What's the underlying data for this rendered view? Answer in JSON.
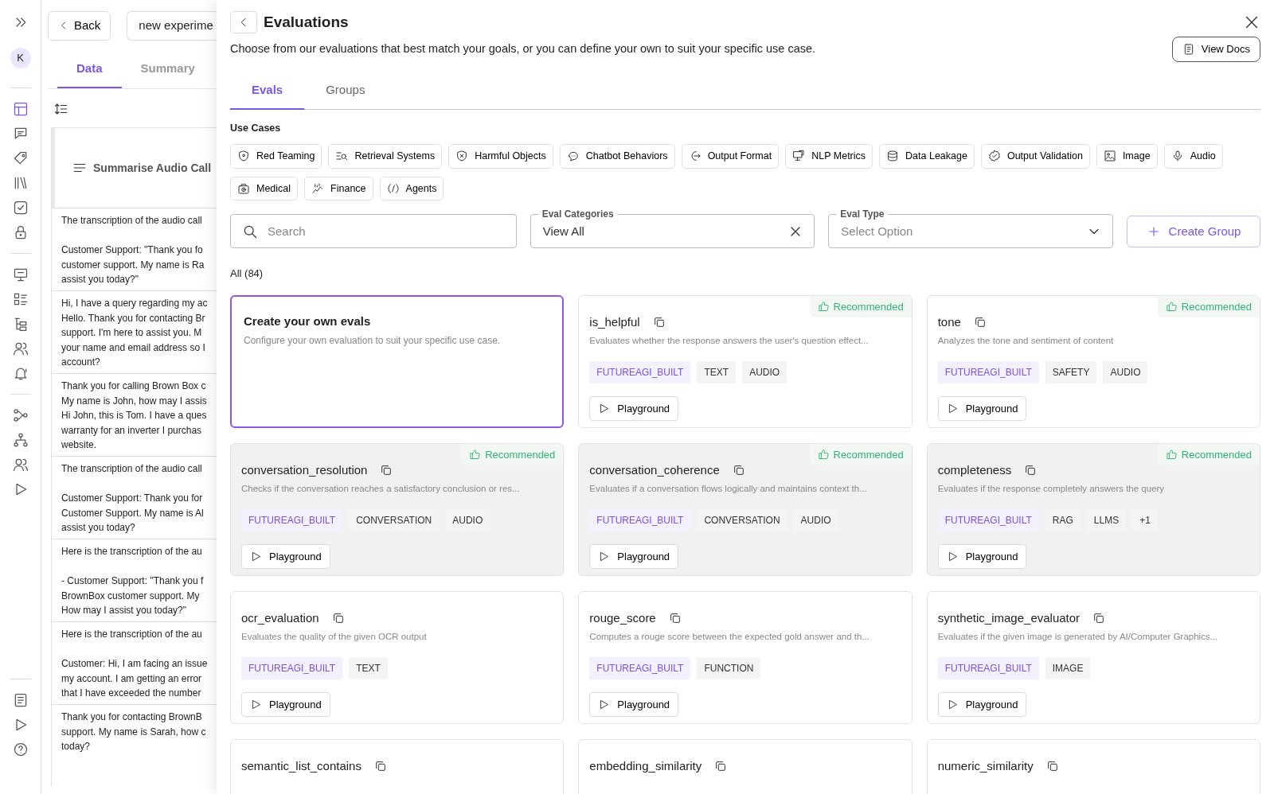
{
  "rail": {
    "avatar": "K",
    "sections": [
      [
        {
          "selected": true
        },
        {
          "selected": false
        },
        {
          "selected": false
        },
        {
          "selected": false
        },
        {
          "selected": false
        },
        {
          "selected": false
        }
      ],
      [
        {
          "selected": false
        },
        {
          "selected": false
        },
        {
          "selected": false
        },
        {
          "selected": false
        },
        {
          "selected": false
        }
      ],
      [
        {
          "selected": false
        },
        {
          "selected": false
        },
        {
          "selected": false
        },
        {
          "selected": false
        }
      ],
      [
        {
          "selected": false
        },
        {
          "selected": false
        },
        {
          "selected": false
        }
      ]
    ]
  },
  "background_page": {
    "back_button": "Back",
    "experiment_name": "new experime",
    "tabs": [
      {
        "label": "Data",
        "selected": true
      },
      {
        "label": "Summary",
        "selected": false
      }
    ],
    "column_header": "Summarise Audio Call",
    "rows": [
      "The transcription of the audio call\n\nCustomer Support: \"Thank you fo\ncustomer support. My name is Ra\nassist you today?\"",
      "Hi, I have a query regarding my ac\nHello. Thank you for contacting Br\nsupport. I'm here to assist you. M\nyour name and email address so I\naccount?",
      "Thank you for calling Brown Box c\nMy name is John, how may I assis\nHi John, this is Tom. I have a ques\nwarranty for an inverter I purchas\nwebsite.",
      "The transcription of the audio call\n\nCustomer Support: Thank you for\nCustomer Support. My name is Al\nassist you today?",
      "Here is the transcription of the au\n\n- Customer Support: \"Thank you f\nBrownBox customer support. My\nHow may I assist you today?\"",
      "Here is the transcription of the au\n\nCustomer: Hi, I am facing an issue\nmy account. I am getting an error\nthat I have exceeded the number",
      "Thank you for contacting BrownB\nsupport. My name is Sarah, how c\ntoday?"
    ]
  },
  "drawer": {
    "title": "Evaluations",
    "subtitle": "Choose from our evaluations that best match your goals, or you can define your own to suit your specific use case.",
    "view_docs_button": "View Docs",
    "tabs": [
      {
        "label": "Evals",
        "selected": true
      },
      {
        "label": "Groups",
        "selected": false
      }
    ],
    "use_cases_label": "Use Cases",
    "use_cases": [
      "Red Teaming",
      "Retrieval Systems",
      "Harmful Objects",
      "Chatbot Behaviors",
      "Output Format",
      "NLP Metrics",
      "Data Leakage",
      "Output Validation",
      "Image",
      "Audio",
      "Medical",
      "Finance",
      "Agents"
    ],
    "search": {
      "placeholder": "Search"
    },
    "eval_categories": {
      "label": "Eval Categories",
      "value": "View All"
    },
    "eval_type": {
      "label": "Eval Type",
      "placeholder": "Select Option"
    },
    "create_group_button": "Create Group",
    "count_label": "All (84)",
    "create_card": {
      "selected": true,
      "title": "Create your own evals",
      "description": "Configure your own evaluation to suit your specific use case."
    },
    "cards": [
      {
        "kind": "eval",
        "name": "is_helpful",
        "description": "Evaluates whether the response answers the user's question effect...",
        "recommended": true,
        "badge": "Recommended",
        "shaded": false,
        "tags": [
          {
            "text": "FUTUREAGI_BUILT",
            "kind": "source"
          },
          {
            "text": "TEXT",
            "kind": "type"
          },
          {
            "text": "AUDIO",
            "kind": "type"
          }
        ],
        "button": "Playground"
      },
      {
        "kind": "eval",
        "name": "tone",
        "description": "Analyzes the tone and sentiment of content",
        "recommended": true,
        "badge": "Recommended",
        "shaded": false,
        "tags": [
          {
            "text": "FUTUREAGI_BUILT",
            "kind": "source"
          },
          {
            "text": "SAFETY",
            "kind": "type"
          },
          {
            "text": "AUDIO",
            "kind": "type"
          }
        ],
        "button": "Playground"
      },
      {
        "kind": "eval",
        "name": "conversation_resolution",
        "description": "Checks if the conversation reaches a satisfactory conclusion or res...",
        "recommended": true,
        "badge": "Recommended",
        "shaded": true,
        "tags": [
          {
            "text": "FUTUREAGI_BUILT",
            "kind": "source"
          },
          {
            "text": "CONVERSATION",
            "kind": "type"
          },
          {
            "text": "AUDIO",
            "kind": "type"
          }
        ],
        "button": "Playground"
      },
      {
        "kind": "eval",
        "name": "conversation_coherence",
        "description": "Evaluates if a conversation flows logically and maintains context th...",
        "recommended": true,
        "badge": "Recommended",
        "shaded": true,
        "tags": [
          {
            "text": "FUTUREAGI_BUILT",
            "kind": "source"
          },
          {
            "text": "CONVERSATION",
            "kind": "type"
          },
          {
            "text": "AUDIO",
            "kind": "type"
          }
        ],
        "button": "Playground"
      },
      {
        "kind": "eval",
        "name": "completeness",
        "description": "Evaluates if the response completely answers the query",
        "recommended": true,
        "badge": "Recommended",
        "shaded": true,
        "tags": [
          {
            "text": "FUTUREAGI_BUILT",
            "kind": "source"
          },
          {
            "text": "RAG",
            "kind": "type"
          },
          {
            "text": "LLMS",
            "kind": "type"
          },
          {
            "text": "+1",
            "kind": "type"
          }
        ],
        "button": "Playground"
      },
      {
        "kind": "eval",
        "name": "ocr_evaluation",
        "description": "Evaluates the quality of the given OCR output",
        "recommended": false,
        "shaded": false,
        "tags": [
          {
            "text": "FUTUREAGI_BUILT",
            "kind": "source"
          },
          {
            "text": "TEXT",
            "kind": "type"
          }
        ],
        "button": "Playground"
      },
      {
        "kind": "eval",
        "name": "rouge_score",
        "description": "Computes a rouge score between the expected gold answer and th...",
        "recommended": false,
        "shaded": false,
        "tags": [
          {
            "text": "FUTUREAGI_BUILT",
            "kind": "source"
          },
          {
            "text": "FUNCTION",
            "kind": "type"
          }
        ],
        "button": "Playground"
      },
      {
        "kind": "eval",
        "name": "synthetic_image_evaluator",
        "description": "Evaluates if the given image is generated by AI/Computer Graphics...",
        "recommended": false,
        "shaded": false,
        "tags": [
          {
            "text": "FUTUREAGI_BUILT",
            "kind": "source"
          },
          {
            "text": "IMAGE",
            "kind": "type"
          }
        ],
        "button": "Playground"
      },
      {
        "kind": "eval",
        "name": "semantic_list_contains",
        "recommended": false,
        "shaded": false
      },
      {
        "kind": "eval",
        "name": "embedding_similarity",
        "recommended": false,
        "shaded": false
      },
      {
        "kind": "eval",
        "name": "numeric_similarity",
        "recommended": false,
        "shaded": false
      }
    ]
  }
}
